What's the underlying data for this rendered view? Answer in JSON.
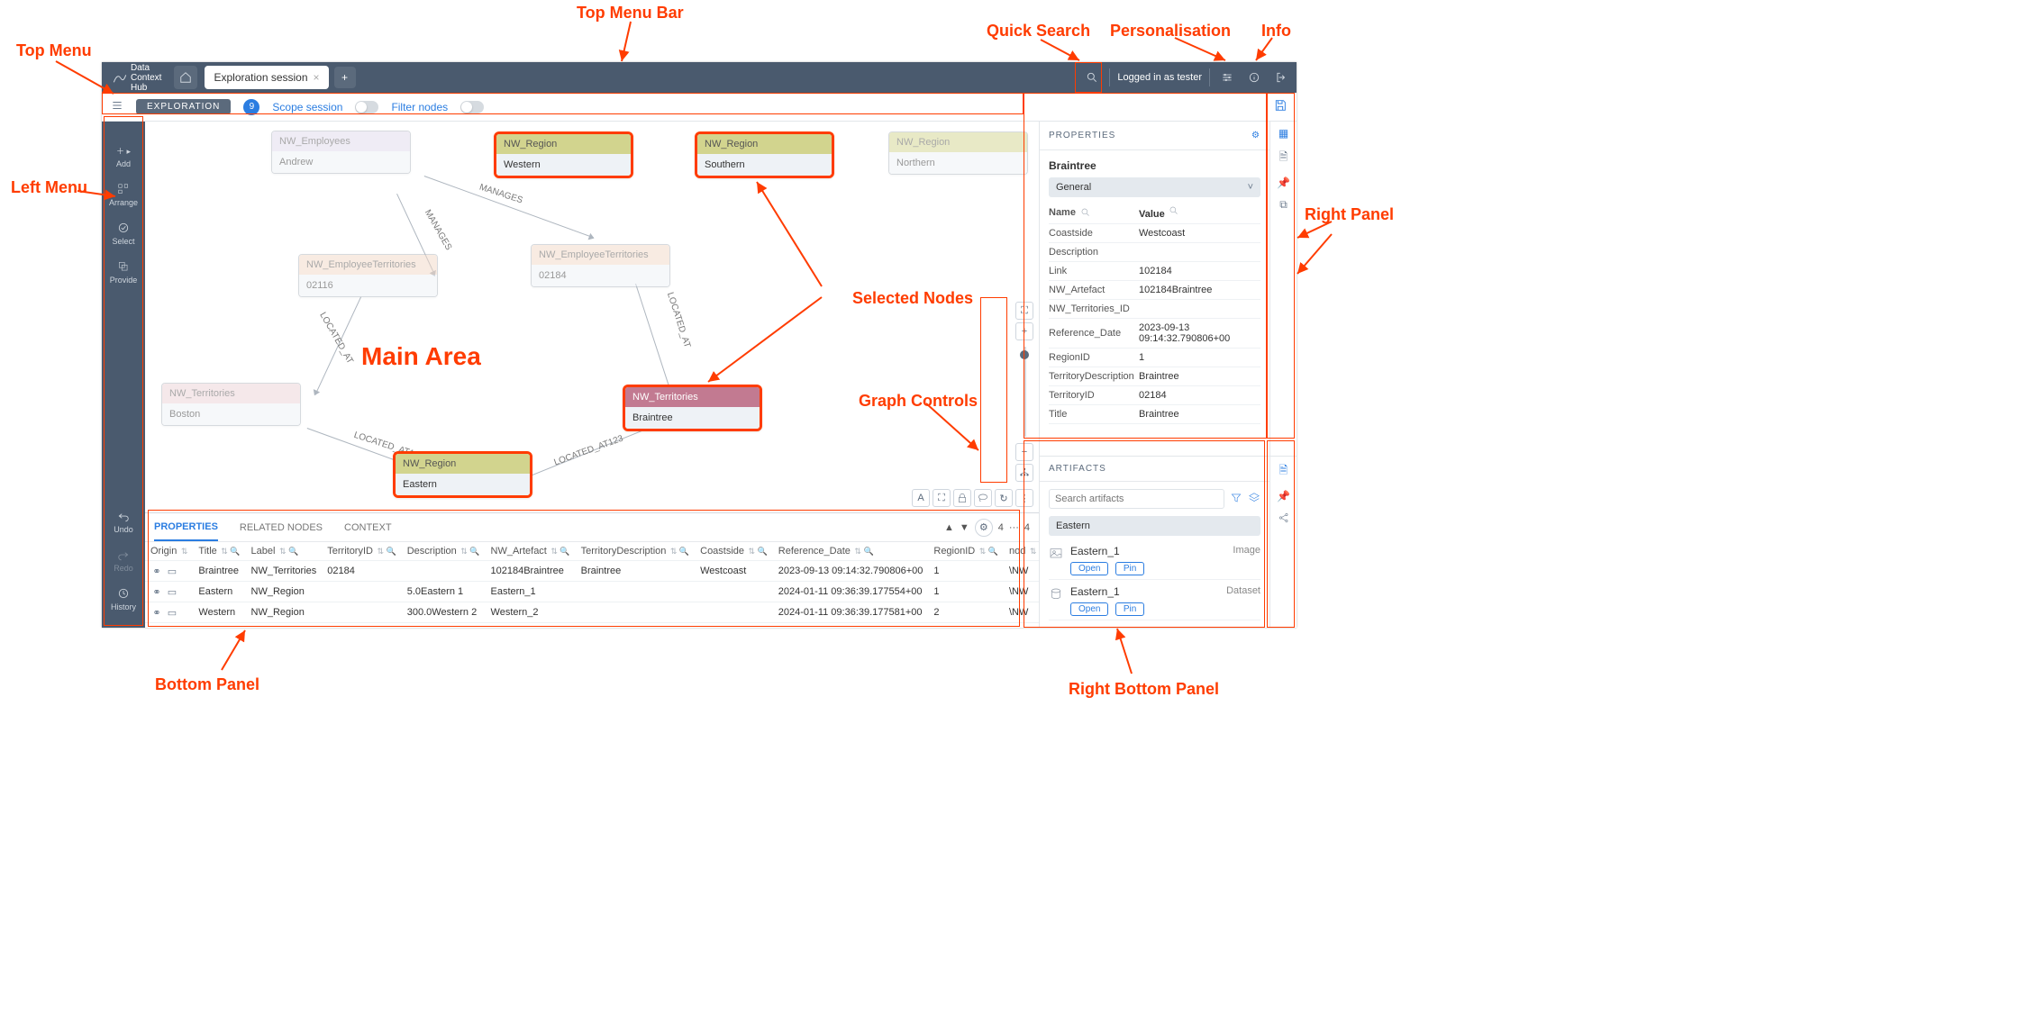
{
  "branding": {
    "line1": "Data",
    "line2": "Context",
    "line3": "Hub"
  },
  "tabs": {
    "active": "Exploration session",
    "add": "+"
  },
  "topbar": {
    "login_text": "Logged in as tester"
  },
  "subtop": {
    "pill": "EXPLORATION",
    "count": "9",
    "scope": "Scope session",
    "filter": "Filter nodes"
  },
  "leftmenu": {
    "add": "Add",
    "arrange": "Arrange",
    "select": "Select",
    "provide": "Provide",
    "undo": "Undo",
    "redo": "Redo",
    "history": "History"
  },
  "graph_nodes": {
    "emp": {
      "type": "NW_Employees",
      "label": "Andrew"
    },
    "rw": {
      "type": "NW_Region",
      "label": "Western"
    },
    "rs": {
      "type": "NW_Region",
      "label": "Southern"
    },
    "rn": {
      "type": "NW_Region",
      "label": "Northern"
    },
    "et1": {
      "type": "NW_EmployeeTerritories",
      "label": "02116"
    },
    "et2": {
      "type": "NW_EmployeeTerritories",
      "label": "02184"
    },
    "tb": {
      "type": "NW_Territories",
      "label": "Boston"
    },
    "tbr": {
      "type": "NW_Territories",
      "label": "Braintree"
    },
    "re": {
      "type": "NW_Region",
      "label": "Eastern"
    }
  },
  "edge_labels": {
    "m1": "MANAGES",
    "m2": "MANAGES",
    "la1": "LOCATED_AT",
    "la2": "LOCATED_AT",
    "la3": "LOCATED_AT123",
    "la4": "LOCATED_AT123"
  },
  "canvas_labels": {
    "main": "Main Area",
    "sel": "Selected Nodes",
    "gc": "Graph Controls"
  },
  "bottom": {
    "tabs": {
      "p": "PROPERTIES",
      "r": "RELATED NODES",
      "c": "CONTEXT"
    },
    "count_l": "4",
    "count_r": "4",
    "dots": "···",
    "cols": [
      "Origin",
      "Title",
      "Label",
      "TerritoryID",
      "Description",
      "NW_Artefact",
      "TerritoryDescription",
      "Coastside",
      "Reference_Date",
      "RegionID",
      "nod"
    ],
    "rows": [
      {
        "title": "Braintree",
        "label": "NW_Territories",
        "tid": "02184",
        "desc": "",
        "art": "102184Braintree",
        "tdesc": "Braintree",
        "coast": "Westcoast",
        "ref": "2023-09-13 09:14:32.790806+00",
        "rid": "1",
        "nod": "\\NW"
      },
      {
        "title": "Eastern",
        "label": "NW_Region",
        "tid": "",
        "desc": "5.0Eastern 1",
        "art": "Eastern_1",
        "tdesc": "",
        "coast": "",
        "ref": "2024-01-11 09:36:39.177554+00",
        "rid": "1",
        "nod": "\\NW"
      },
      {
        "title": "Western",
        "label": "NW_Region",
        "tid": "",
        "desc": "300.0Western 2",
        "art": "Western_2",
        "tdesc": "",
        "coast": "",
        "ref": "2024-01-11 09:36:39.177581+00",
        "rid": "2",
        "nod": "\\NW"
      }
    ]
  },
  "props": {
    "header": "PROPERTIES",
    "title": "Braintree",
    "general": "General",
    "name_h": "Name",
    "value_h": "Value",
    "rows": [
      {
        "k": "Coastside",
        "v": "Westcoast"
      },
      {
        "k": "Description",
        "v": ""
      },
      {
        "k": "Link",
        "v": "102184"
      },
      {
        "k": "NW_Artefact",
        "v": "102184Braintree"
      },
      {
        "k": "NW_Territories_ID",
        "v": ""
      },
      {
        "k": "Reference_Date",
        "v": "2023-09-13 09:14:32.790806+00"
      },
      {
        "k": "RegionID",
        "v": "1"
      },
      {
        "k": "TerritoryDescription",
        "v": "Braintree"
      },
      {
        "k": "TerritoryID",
        "v": "02184"
      },
      {
        "k": "Title",
        "v": "Braintree"
      }
    ]
  },
  "artifacts": {
    "header": "ARTIFACTS",
    "search_ph": "Search artifacts",
    "group": "Eastern",
    "items": [
      {
        "name": "Eastern_1",
        "type": "Image",
        "open": "Open",
        "pin": "Pin"
      },
      {
        "name": "Eastern_1",
        "type": "Dataset",
        "open": "Open",
        "pin": "Pin"
      }
    ]
  },
  "annot": {
    "topmenubar": "Top Menu Bar",
    "quicksearch": "Quick Search",
    "personal": "Personalisation",
    "info": "Info",
    "topmenu": "Top Menu",
    "leftmenu": "Left Menu",
    "rightpanel": "Right Panel",
    "bottompanel": "Bottom Panel",
    "rightbottom": "Right Bottom Panel"
  }
}
